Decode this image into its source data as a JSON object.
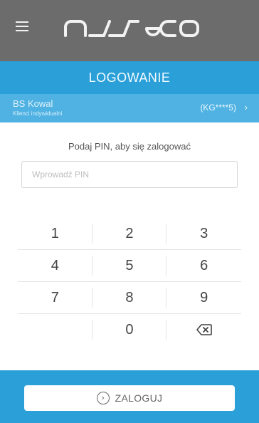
{
  "header": {
    "logo_text": "asseco"
  },
  "title": "LOGOWANIE",
  "client": {
    "name": "BS Kowal",
    "type": "Klienci indywidualni",
    "id": "(KG****5)",
    "chevron": "›"
  },
  "login": {
    "prompt": "Podaj PIN, aby się zalogować",
    "pin_placeholder": "Wprowadź PIN",
    "pin_value": ""
  },
  "keypad": {
    "keys": [
      "1",
      "2",
      "3",
      "4",
      "5",
      "6",
      "7",
      "8",
      "9",
      "",
      "0",
      "⌫"
    ]
  },
  "footer": {
    "button_label": "ZALOGUJ",
    "button_icon": "›"
  },
  "colors": {
    "topbar": "#6c6c6c",
    "title_bar": "#2a9fd8",
    "client_bar": "#4fb2e3"
  }
}
